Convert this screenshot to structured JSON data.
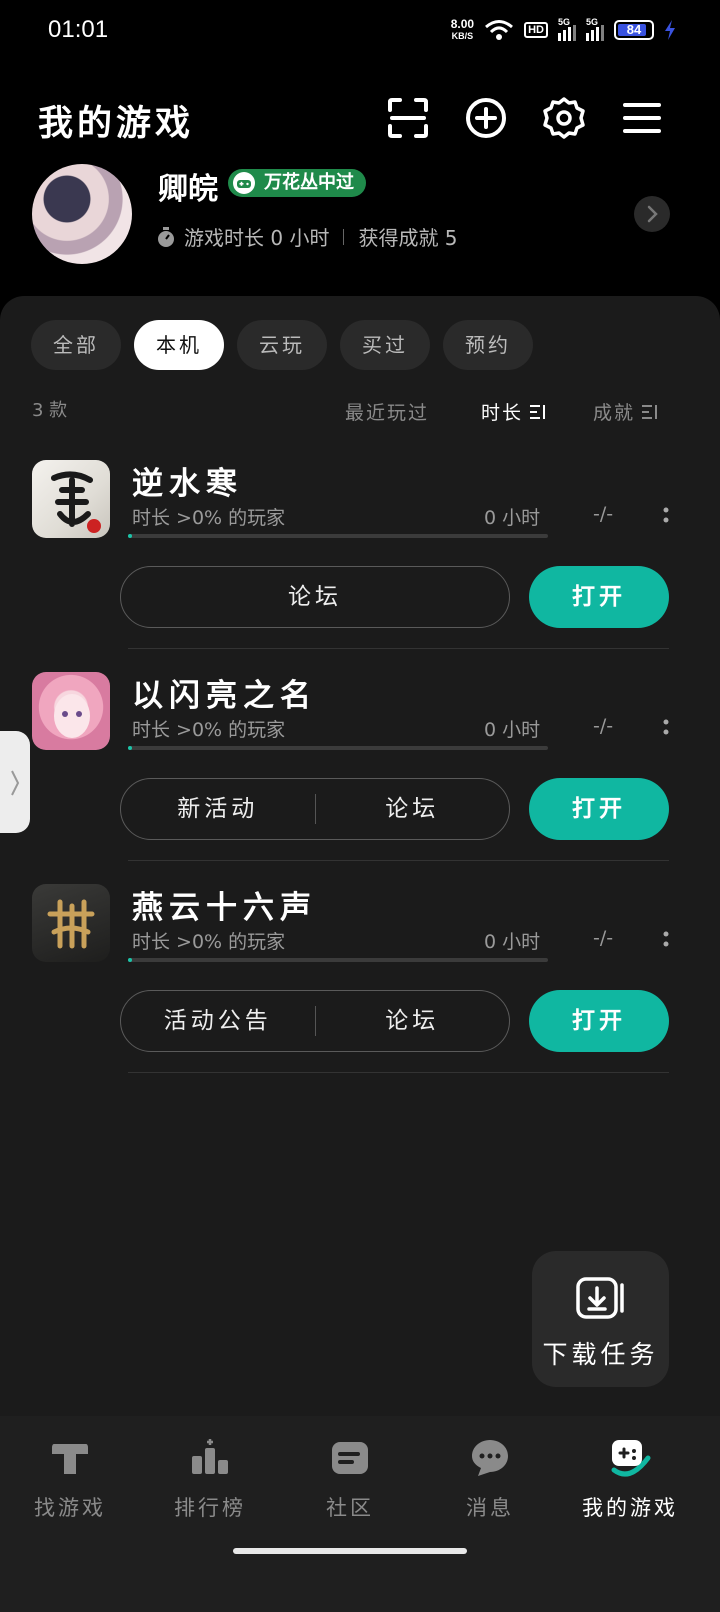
{
  "status_bar": {
    "time": "01:01",
    "net_speed": "8.00",
    "net_unit": "KB/S",
    "hd_label": "HD",
    "sim1_label": "5G",
    "sim2_label": "5G",
    "battery": "84",
    "battery_color": "#3a53e0"
  },
  "header": {
    "title": "我的游戏",
    "icons": [
      "scan-icon",
      "add-icon",
      "settings-icon",
      "menu-icon"
    ]
  },
  "profile": {
    "name": "卿皖",
    "badge": "万花丛中过",
    "playtime": "游戏时长 0 小时",
    "achievements": "获得成就 5"
  },
  "tabs": [
    {
      "label": "全部",
      "active": false
    },
    {
      "label": "本机",
      "active": true
    },
    {
      "label": "云玩",
      "active": false
    },
    {
      "label": "买过",
      "active": false
    },
    {
      "label": "预约",
      "active": false
    }
  ],
  "list": {
    "count": "3 款",
    "sort_recent": "最近玩过",
    "sort_duration": "时长",
    "sort_achievement": "成就"
  },
  "games": [
    {
      "title": "逆水寒",
      "rank": "时长 >0% 的玩家",
      "hours": "0 小时",
      "achievement": "-/-",
      "buttons": [
        "论坛"
      ],
      "open": "打开"
    },
    {
      "title": "以闪亮之名",
      "rank": "时长 >0% 的玩家",
      "hours": "0 小时",
      "achievement": "-/-",
      "buttons": [
        "新活动",
        "论坛"
      ],
      "open": "打开"
    },
    {
      "title": "燕云十六声",
      "rank": "时长 >0% 的玩家",
      "hours": "0 小时",
      "achievement": "-/-",
      "buttons": [
        "活动公告",
        "论坛"
      ],
      "open": "打开"
    }
  ],
  "download_task": "下载任务",
  "bottom_nav": [
    {
      "label": "找游戏",
      "icon": "find-game-icon",
      "active": false
    },
    {
      "label": "排行榜",
      "icon": "leaderboard-icon",
      "active": false
    },
    {
      "label": "社区",
      "icon": "community-icon",
      "active": false
    },
    {
      "label": "消息",
      "icon": "message-icon",
      "active": false
    },
    {
      "label": "我的游戏",
      "icon": "my-games-icon",
      "active": true
    }
  ],
  "colors": {
    "accent": "#10b7a1",
    "badge_green": "#1f8a4a",
    "background": "#000000",
    "card": "#1b1b1b"
  }
}
